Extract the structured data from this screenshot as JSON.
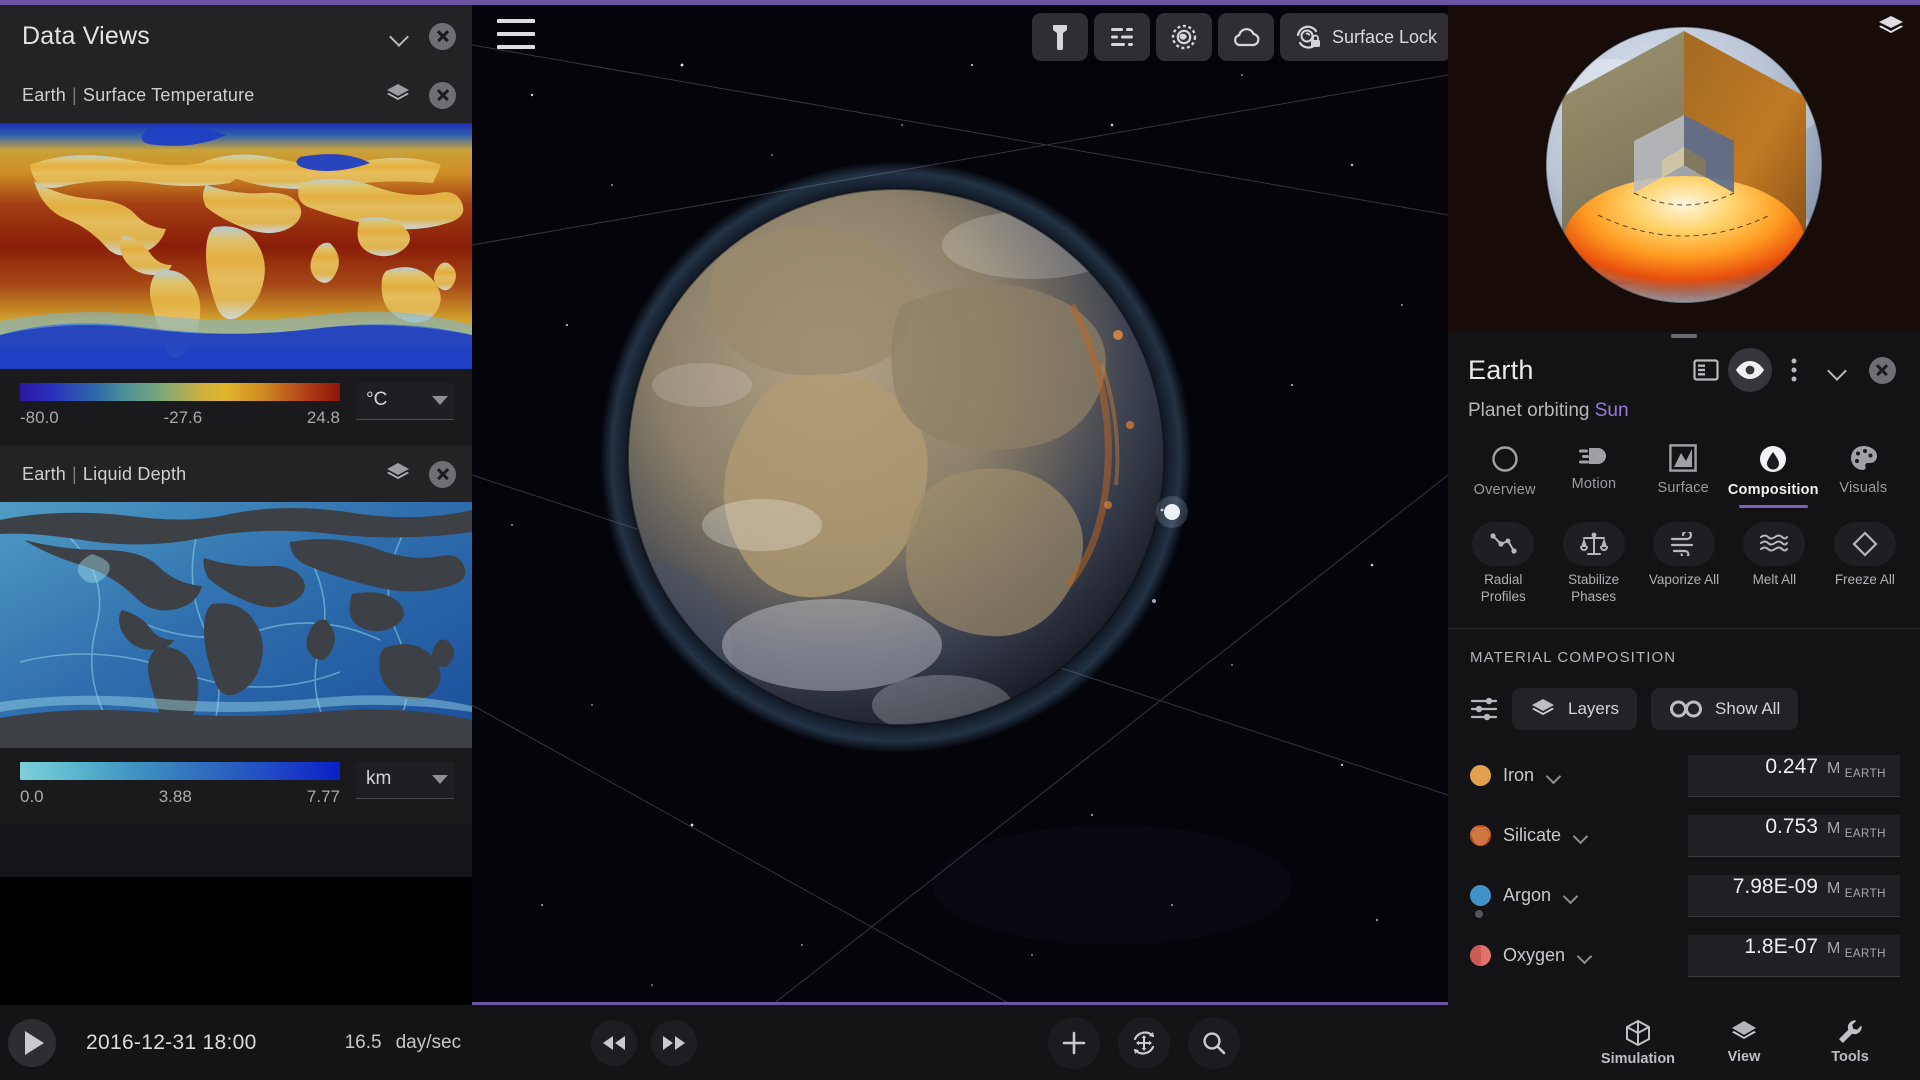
{
  "left_panel": {
    "title": "Data Views",
    "collapse_icon": "chevron-down-icon",
    "close_icon": "close-icon",
    "views": [
      {
        "body": "Earth",
        "separator": "|",
        "metric": "Surface Temperature",
        "layers_icon": "layers-icon",
        "close_icon": "close-icon",
        "scale": {
          "min": "-80.0",
          "mid": "-27.6",
          "max": "24.8"
        },
        "unit": "°C",
        "unit_dropdown_icon": "triangle-down-icon",
        "map_type": "surface-temperature-world-map"
      },
      {
        "body": "Earth",
        "separator": "|",
        "metric": "Liquid Depth",
        "layers_icon": "layers-icon",
        "close_icon": "close-icon",
        "scale": {
          "min": "0.0",
          "mid": "3.88",
          "max": "7.77"
        },
        "unit": "km",
        "unit_dropdown_icon": "triangle-down-icon",
        "map_type": "liquid-depth-world-map"
      }
    ]
  },
  "viewport": {
    "menu_icon": "hamburger-menu-icon",
    "toolbar": [
      {
        "icon": "flashlight-icon",
        "label": ""
      },
      {
        "icon": "wind-sliders-icon",
        "label": ""
      },
      {
        "icon": "radiation-sun-icon",
        "label": ""
      },
      {
        "icon": "cloud-icon",
        "label": ""
      },
      {
        "icon": "surface-lock-icon",
        "label": "Surface Lock"
      }
    ]
  },
  "right_panel": {
    "cutaway_layers_icon": "layers-icon",
    "title": "Earth",
    "subtitle_prefix": "Planet orbiting ",
    "subtitle_link": "Sun",
    "header_icons": [
      {
        "name": "info-panel-icon",
        "active": false
      },
      {
        "name": "eye-icon",
        "active": true
      },
      {
        "name": "more-vertical-icon",
        "active": false
      },
      {
        "name": "chevron-down-icon",
        "active": false
      },
      {
        "name": "close-icon",
        "active": false
      }
    ],
    "tabs": [
      {
        "label": "Overview",
        "icon": "circle-outline-icon",
        "active": false
      },
      {
        "label": "Motion",
        "icon": "motion-icon",
        "active": false
      },
      {
        "label": "Surface",
        "icon": "surface-icon",
        "active": false
      },
      {
        "label": "Composition",
        "icon": "droplet-circle-icon",
        "active": true
      },
      {
        "label": "Visuals",
        "icon": "palette-icon",
        "active": false
      }
    ],
    "actions": [
      {
        "label": "Radial Profiles",
        "icon": "node-graph-icon"
      },
      {
        "label": "Stabilize Phases",
        "icon": "scales-icon"
      },
      {
        "label": "Vaporize All",
        "icon": "wind-icon"
      },
      {
        "label": "Melt All",
        "icon": "waves-icon"
      },
      {
        "label": "Freeze All",
        "icon": "diamond-icon"
      }
    ],
    "section_title": "MATERIAL COMPOSITION",
    "tools": {
      "settings_icon": "sliders-icon",
      "layers_label": "Layers",
      "layers_icon": "layers-icon",
      "show_all_label": "Show All",
      "show_all_icon": "infinity-icon"
    },
    "unit_symbol": "M",
    "unit_sub": "EARTH",
    "materials": [
      {
        "name": "Iron",
        "value": "0.247",
        "color": "#e2a04f",
        "icon": "solid-circle-icon",
        "has_subdot": false
      },
      {
        "name": "Silicate",
        "value": "0.753",
        "color": "#d96a60",
        "icon": "rings-circle-icon",
        "has_subdot": false
      },
      {
        "name": "Argon",
        "value": "7.98E-09",
        "color": "#3f93c9",
        "icon": "solid-circle-icon",
        "has_subdot": true
      },
      {
        "name": "Oxygen",
        "value": "1.8E-07",
        "color": "#e0726a",
        "icon": "split-circle-icon",
        "has_subdot": true
      }
    ]
  },
  "bottom_bar": {
    "play_icon": "play-icon",
    "datetime": "2016-12-31 18:00",
    "rate_value": "16.5",
    "rate_unit": "day/sec",
    "rewind_icon": "rewind-icon",
    "forward_icon": "fast-forward-icon",
    "center_buttons": [
      {
        "icon": "plus-icon"
      },
      {
        "icon": "orbit-move-icon"
      },
      {
        "icon": "search-icon"
      }
    ],
    "right_buttons": [
      {
        "label": "Simulation",
        "icon": "cube-icon"
      },
      {
        "label": "View",
        "icon": "layers-icon"
      },
      {
        "label": "Tools",
        "icon": "wrench-icon"
      }
    ]
  },
  "colors": {
    "accent": "#6b54a3",
    "link": "#9a7ae0",
    "panel_bg": "#16161a",
    "card_bg": "#232326"
  }
}
